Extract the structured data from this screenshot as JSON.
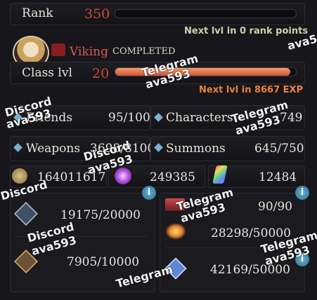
{
  "rank": {
    "label": "Rank",
    "value": "350",
    "progress": 0.0,
    "next_text": "Next lvl in 0 rank points"
  },
  "class": {
    "name": "Viking",
    "status": "COMPLETED",
    "label": "Class lvl",
    "value": "20",
    "progress": 0.97,
    "next_text": "Next lvl in 8667 EXP"
  },
  "stats": {
    "friends": {
      "label": "Friends",
      "value": "95/100"
    },
    "characters": {
      "label": "Characters",
      "value": "749"
    },
    "weapons": {
      "label": "Weapons",
      "value": "3698/8100"
    },
    "summons": {
      "label": "Summons",
      "value": "645/750"
    }
  },
  "currency": {
    "rupies": "164011617",
    "crystals": "249385",
    "shards": "12484"
  },
  "resources_left": [
    {
      "name": "ap",
      "value": "19175/20000"
    },
    {
      "name": "bp",
      "value": "7905/10000"
    }
  ],
  "resources_right": [
    {
      "name": "tickets",
      "value": "90/90"
    },
    {
      "name": "burst",
      "value": "28298/50000"
    },
    {
      "name": "hearts",
      "value": "42169/50000"
    }
  ],
  "watermarks": [
    "Telegram",
    "ava593",
    "Discord",
    "ava593",
    "Telegram",
    "ava593",
    "Discord",
    "ava593",
    "Telegram",
    "ava593",
    "Discord",
    "ava593",
    "Telegram",
    "ava593",
    "Telegram",
    "ava593",
    "Discord"
  ],
  "colors": {
    "accent_red": "#c94a37",
    "accent_orange": "#e8823c",
    "text_green": "#c6d6a6",
    "diamond_blue": "#7ab1d0"
  }
}
